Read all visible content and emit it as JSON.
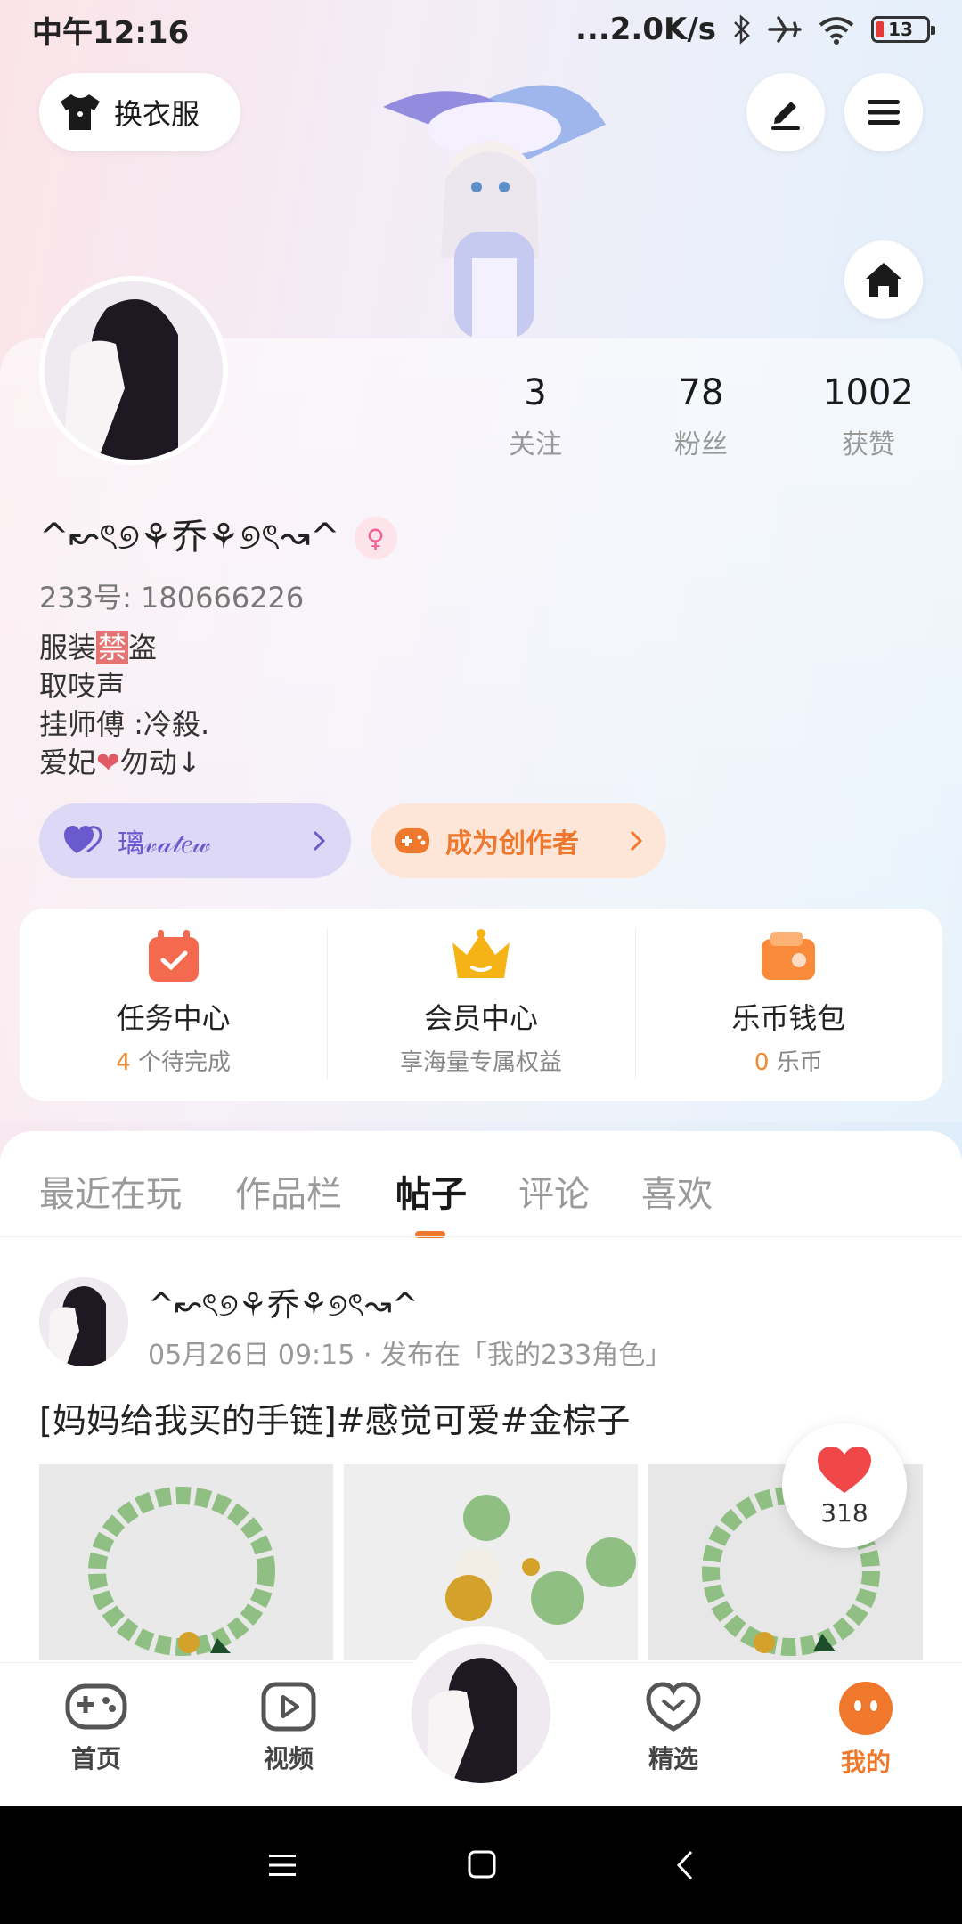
{
  "status_bar": {
    "time": "中午12:16",
    "network_speed": "...2.0K/s",
    "battery": "13"
  },
  "header": {
    "outfit_label": "换衣服"
  },
  "profile": {
    "stats": [
      {
        "value": "3",
        "label": "关注"
      },
      {
        "value": "78",
        "label": "粉丝"
      },
      {
        "value": "1002",
        "label": "获赞"
      }
    ],
    "nickname": "^↜ৎ୭⚘乔⚘୭ৎ↝^",
    "gender_symbol": "♀",
    "uid": "233号: 180666226",
    "bio": {
      "line1_a": "服装",
      "line1_ban": "禁",
      "line1_b": "盗",
      "line2": "取吱声",
      "line3": "挂师傅 :冷殺.",
      "line4_a": "爱妃",
      "line4_heart": "❤",
      "line4_b": "勿动↓"
    },
    "badge_label": "璃𝓋𝒶𝓉𝑒𝓌",
    "creator_label": "成为创作者"
  },
  "services": [
    {
      "title": "任务中心",
      "sub_highlight": "4",
      "sub_text": " 个待完成",
      "icon": "calendar-check-icon",
      "color": "#f46a4e"
    },
    {
      "title": "会员中心",
      "sub_highlight": "",
      "sub_text": "享海量专属权益",
      "icon": "crown-icon",
      "color": "#f5b316"
    },
    {
      "title": "乐币钱包",
      "sub_highlight": "0",
      "sub_text": " 乐币",
      "icon": "wallet-icon",
      "color": "#f98a3a"
    }
  ],
  "tabs": [
    "最近在玩",
    "作品栏",
    "帖子",
    "评论",
    "喜欢"
  ],
  "active_tab": "帖子",
  "post": {
    "author": "^↜ৎ୭⚘乔⚘୭ৎ↝^",
    "meta": "05月26日 09:15 · 发布在「我的233角色」",
    "text": "[妈妈给我买的手链]#感觉可爱#金棕子",
    "likes": "318"
  },
  "bottom_nav": {
    "items": [
      {
        "label": "首页",
        "icon": "gamepad-icon"
      },
      {
        "label": "视频",
        "icon": "video-icon"
      },
      {
        "label": "精选",
        "icon": "heart-chat-icon"
      },
      {
        "label": "我的",
        "icon": "face-icon"
      }
    ],
    "active": "我的"
  },
  "colors": {
    "accent": "#f0782d",
    "badge_purple": "#6a5acd",
    "like_red": "#f04848"
  }
}
